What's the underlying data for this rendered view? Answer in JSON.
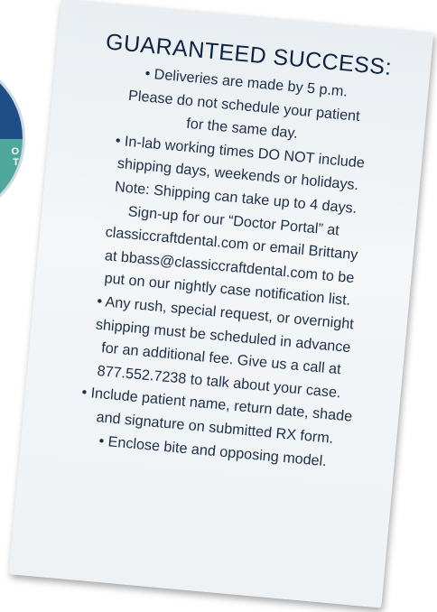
{
  "badge": {
    "text_line1": "O",
    "text_line2": "T"
  },
  "card": {
    "title": "GUARANTEED SUCCESS:",
    "lines": [
      "• Deliveries are made by 5 p.m.",
      "Please do not schedule your patient",
      "for the same day.",
      "• In-lab working times DO NOT include",
      "shipping days, weekends or holidays.",
      "Note: Shipping can take up to 4 days.",
      "Sign-up for our “Doctor Portal” at",
      "classiccraftdental.com or email Brittany",
      "at bbass@classiccraftdental.com to be",
      "put on our nightly case notification list.",
      "• Any rush, special request, or overnight",
      "shipping must be scheduled in advance",
      "for an additional fee. Give us a call at",
      "877.552.7238 to talk about your case.",
      "• Include patient name, return date, shade",
      "and signature on submitted RX form.",
      "• Enclose bite and opposing model."
    ]
  }
}
